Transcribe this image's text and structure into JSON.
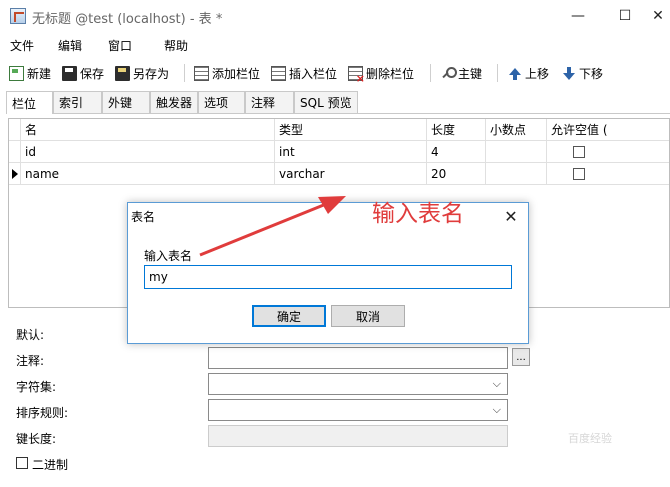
{
  "window": {
    "title": "无标题 @test (localhost) - 表 *",
    "min_icon": "minimize-icon",
    "max_icon": "maximize-icon",
    "close_icon": "close-icon",
    "close_glyph": "✕",
    "min_glyph": "—",
    "max_glyph": "☐"
  },
  "menu": {
    "file": "文件",
    "edit": "编辑",
    "window": "窗口",
    "help": "帮助"
  },
  "toolbar": {
    "new": "新建",
    "save": "保存",
    "save_as": "另存为",
    "add_column": "添加栏位",
    "insert_column": "插入栏位",
    "delete_column": "删除栏位",
    "primary_key": "主键",
    "move_up": "上移",
    "move_down": "下移"
  },
  "tabs": [
    "栏位",
    "索引",
    "外键",
    "触发器",
    "选项",
    "注释",
    "SQL 预览"
  ],
  "grid": {
    "headers": [
      "名",
      "类型",
      "长度",
      "小数点",
      "允许空值 ("
    ],
    "rows": [
      {
        "name": "id",
        "type": "int",
        "length": "4",
        "decimals": "",
        "nullable": false
      },
      {
        "name": "name",
        "type": "varchar",
        "length": "20",
        "decimals": "",
        "nullable": false,
        "current": true
      }
    ]
  },
  "props": {
    "default_label": "默认:",
    "comment_label": "注释:",
    "charset_label": "字符集:",
    "collation_label": "排序规则:",
    "key_length_label": "键长度:",
    "binary_label": "二进制",
    "ellipsis": "...",
    "chevron": "⌵"
  },
  "dialog": {
    "title": "表名",
    "close_glyph": "✕",
    "prompt": "输入表名",
    "value": "my",
    "ok": "确定",
    "cancel": "取消"
  },
  "annotation": {
    "text": "输入表名",
    "color": "#e03c3c"
  },
  "watermark": "百度经验"
}
